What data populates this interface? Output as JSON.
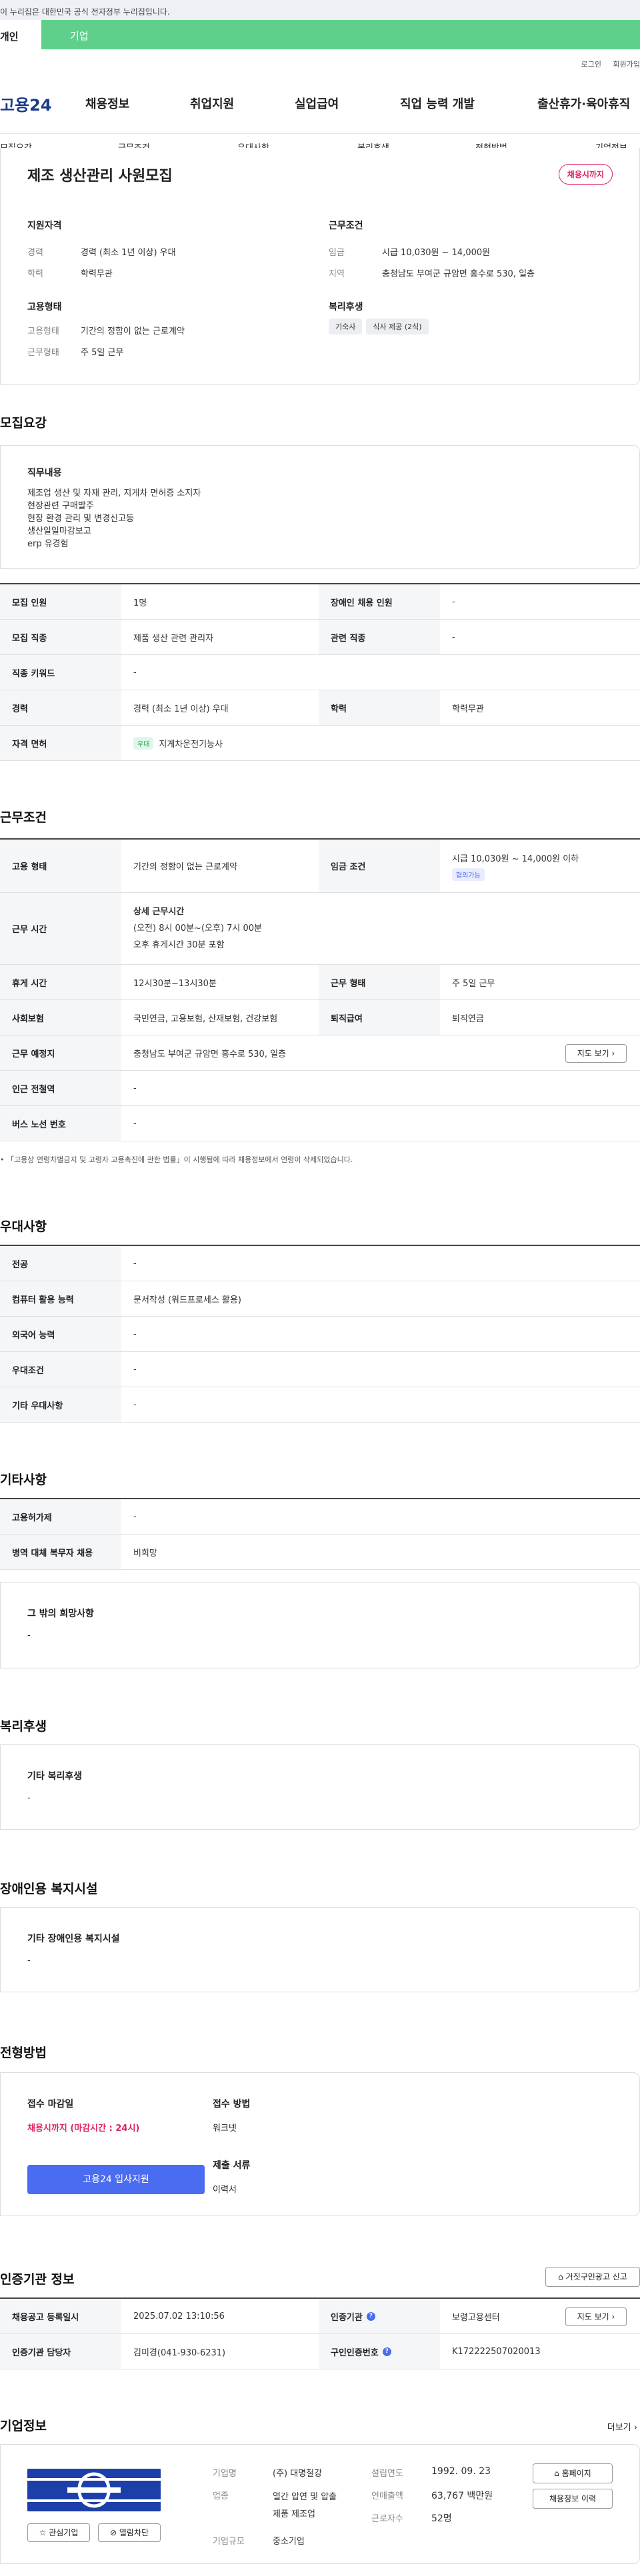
{
  "topnote": "이 누리집은 대한민국 공식 전자정부 누리집입니다.",
  "tabs": {
    "personal": "개인",
    "company": "기업"
  },
  "util": {
    "login": "로그인",
    "join": "회원가입"
  },
  "gnb": {
    "logo": "고용24",
    "items": [
      "채용정보",
      "취업지원",
      "실업급여",
      "직업 능력 개발",
      "출산휴가·육아휴직"
    ]
  },
  "subnav": [
    "모집요강",
    "근무조건",
    "우대사항",
    "복리후생",
    "전형방법",
    "기업정보"
  ],
  "job": {
    "title": "제조 생산관리 사원모집",
    "status": "채용시까지",
    "qual_head": "지원자격",
    "career_lbl": "경력",
    "career_val": "경력 (최소 1년 이상) 우대",
    "edu_lbl": "학력",
    "edu_val": "학력무관",
    "cond_head": "근무조건",
    "wage_lbl": "임금",
    "wage_val": "시급 10,030원 ~ 14,000원",
    "region_lbl": "지역",
    "region_val": "충청남도 부여군 규암면 홍수로 530, 일층",
    "emp_head": "고용형태",
    "emptype_lbl": "고용형태",
    "emptype_val": "기간의 정함이 없는 근로계약",
    "worktype_lbl": "근무형태",
    "worktype_val": "주 5일 근무",
    "welfare_head": "복리후생",
    "welfare_pills": [
      "기숙사",
      "식사 제공 (2식)"
    ]
  },
  "recruit": {
    "title": "모집요강",
    "duty_head": "직무내용",
    "duty_lines": [
      "제조업 생산 및 자재 관리, 지게차 면허증 소지자",
      "현장관련 구매발주",
      "현장 환경 관리 및 변경신고등",
      "생산일일마감보고",
      "erp 유경험"
    ],
    "rows": [
      {
        "k1": "모집 인원",
        "v1": "1명",
        "k2": "장애인 채용 인원",
        "v2": "-"
      },
      {
        "k1": "모집 직종",
        "v1": "제품 생산 관련 관리자",
        "k2": "관련 직종",
        "v2": "-"
      },
      {
        "k1": "직종 키워드",
        "v1": "-"
      },
      {
        "k1": "경력",
        "v1": "경력 (최소 1년 이상) 우대",
        "k2": "학력",
        "v2": "학력무관"
      }
    ],
    "license_k": "자격 면허",
    "license_badge": "우대",
    "license_v": "지게차운전기능사"
  },
  "work": {
    "title": "근무조건",
    "emp_k": "고용 형태",
    "emp_v": "기간의 정함이 없는 근로계약",
    "wage_k": "임금 조건",
    "wage_v": "시급 10,030원 ~ 14,000원 이하",
    "wage_badge": "협의가능",
    "time_k": "근무 시간",
    "time_head": "상세 근무시간",
    "time_l1": "(오전) 8시 00분~(오후) 7시 00분",
    "time_l2": "오후 휴게시간 30분 포함",
    "rest_k": "휴게 시간",
    "rest_v": "12시30분~13시30분",
    "form_k": "근무 형태",
    "form_v": "주 5일 근무",
    "ins_k": "사회보험",
    "ins_v": "국민연금, 고용보험, 산재보험, 건강보험",
    "ret_k": "퇴직급여",
    "ret_v": "퇴직연금",
    "place_k": "근무 예정지",
    "place_v": "충청남도 부여군 규암면 홍수로 530, 일층",
    "map_btn": "지도 보기",
    "station_k": "인근 전철역",
    "station_v": "-",
    "bus_k": "버스 노선 번호",
    "bus_v": "-",
    "note": "「고용상 연령차별금지 및 고령자 고용촉진에 관한 법률」이 시행됨에 따라 채용정보에서 연령이 삭제되었습니다."
  },
  "pref": {
    "title": "우대사항",
    "rows": [
      {
        "k": "전공",
        "v": "-"
      },
      {
        "k": "컴퓨터 활용 능력",
        "v": "문서작성 (워드프로세스 활용)"
      },
      {
        "k": "외국어 능력",
        "v": "-"
      },
      {
        "k": "우대조건",
        "v": "-"
      },
      {
        "k": "기타 우대사항",
        "v": "-"
      }
    ]
  },
  "etc": {
    "title": "기타사항",
    "rows": [
      {
        "k": "고용허가제",
        "v": "-"
      },
      {
        "k": "병역 대체 복무자 채용",
        "v": "비희망"
      }
    ],
    "box_head": "그 밖의 희망사항",
    "box_v": "-"
  },
  "welfare": {
    "title": "복리후생",
    "head": "기타 복리후생",
    "v": "-"
  },
  "disabled": {
    "title": "장애인용 복지시설",
    "head": "기타 장애인용 복지시설",
    "v": "-"
  },
  "selection": {
    "title": "전형방법",
    "deadline_head": "접수 마감일",
    "deadline_v": "채용시까지 (마감시간 : 24시)",
    "apply_btn": "고용24 입사지원",
    "method_head": "접수 방법",
    "method_v": "워크넷",
    "docs_head": "제출 서류",
    "docs_v": "이력서"
  },
  "agency": {
    "title": "인증기관 정보",
    "report_btn": "거짓구인광고 신고",
    "reg_k": "채용공고 등록일시",
    "reg_v": "2025.07.02 13:10:56",
    "cert_k": "인증기관",
    "cert_v": "보령고용센터",
    "map_btn": "지도 보기",
    "mgr_k": "인증기관 담당자",
    "mgr_v": "김미경(041-930-6231)",
    "num_k": "구인인증번호",
    "num_v": "K172222507020013"
  },
  "company": {
    "title": "기업정보",
    "more": "더보기",
    "fav_btn": "관심기업",
    "block_btn": "열람차단",
    "name_k": "기업명",
    "name_v": "(주) 대명철강",
    "ind_k": "업종",
    "ind_l1": "열간 압연 및 압출",
    "ind_l2": "제품 제조업",
    "size_k": "기업규모",
    "size_v": "중소기업",
    "est_k": "설립연도",
    "est_v": "1992. 09. 23",
    "sales_k": "연매출액",
    "sales_v": "63,767 백만원",
    "emp_k": "근로자수",
    "emp_v": "52명",
    "home_btn": "홈페이지",
    "hist_btn": "채용정보 이력"
  },
  "colors": {
    "green": "#5fd08c",
    "red": "#e0245e",
    "blue": "#4a6cf0"
  }
}
